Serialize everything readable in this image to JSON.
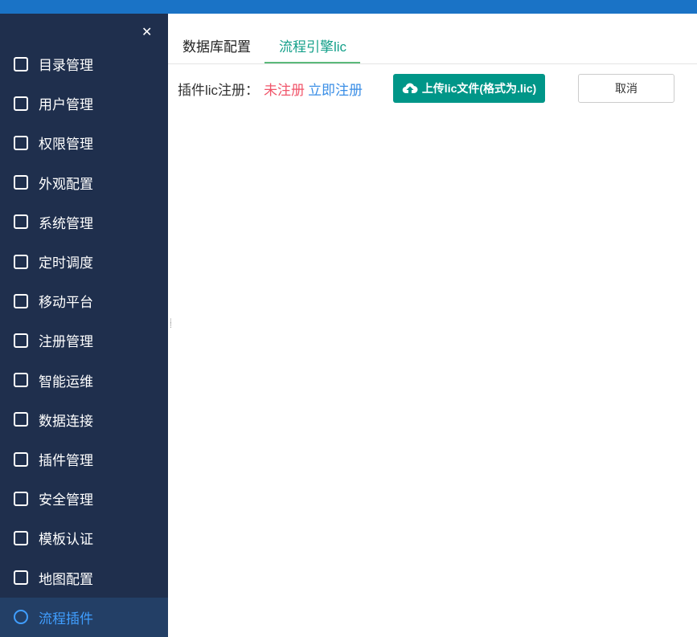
{
  "sidebar": {
    "items": [
      {
        "label": "目录管理",
        "icon": "list-icon"
      },
      {
        "label": "用户管理",
        "icon": "user-icon"
      },
      {
        "label": "权限管理",
        "icon": "lock-icon"
      },
      {
        "label": "外观配置",
        "icon": "paint-roller-icon"
      },
      {
        "label": "系统管理",
        "icon": "gear-icon"
      },
      {
        "label": "定时调度",
        "icon": "timer-icon"
      },
      {
        "label": "移动平台",
        "icon": "mobile-icon"
      },
      {
        "label": "注册管理",
        "icon": "register-icon"
      },
      {
        "label": "智能运维",
        "icon": "network-icon"
      },
      {
        "label": "数据连接",
        "icon": "paperclip-icon"
      },
      {
        "label": "插件管理",
        "icon": "puzzle-icon"
      },
      {
        "label": "安全管理",
        "icon": "shield-icon"
      },
      {
        "label": "模板认证",
        "icon": "document-edit-icon"
      },
      {
        "label": "地图配置",
        "icon": "map-icon"
      },
      {
        "label": "流程插件",
        "icon": "gear-icon",
        "active": true
      }
    ]
  },
  "tabs": [
    {
      "label": "数据库配置"
    },
    {
      "label": "流程引擎lic",
      "active": true
    }
  ],
  "main": {
    "label": "插件lic注册：",
    "status": "未注册",
    "register_link": "立即注册",
    "upload_button": "上传lic文件(格式为.lic)",
    "cancel_button": "取消"
  },
  "colors": {
    "accent": "#009688",
    "sidebar": "#1f2f4d",
    "status_red": "#f0556a",
    "link_blue": "#3a8ee6"
  }
}
